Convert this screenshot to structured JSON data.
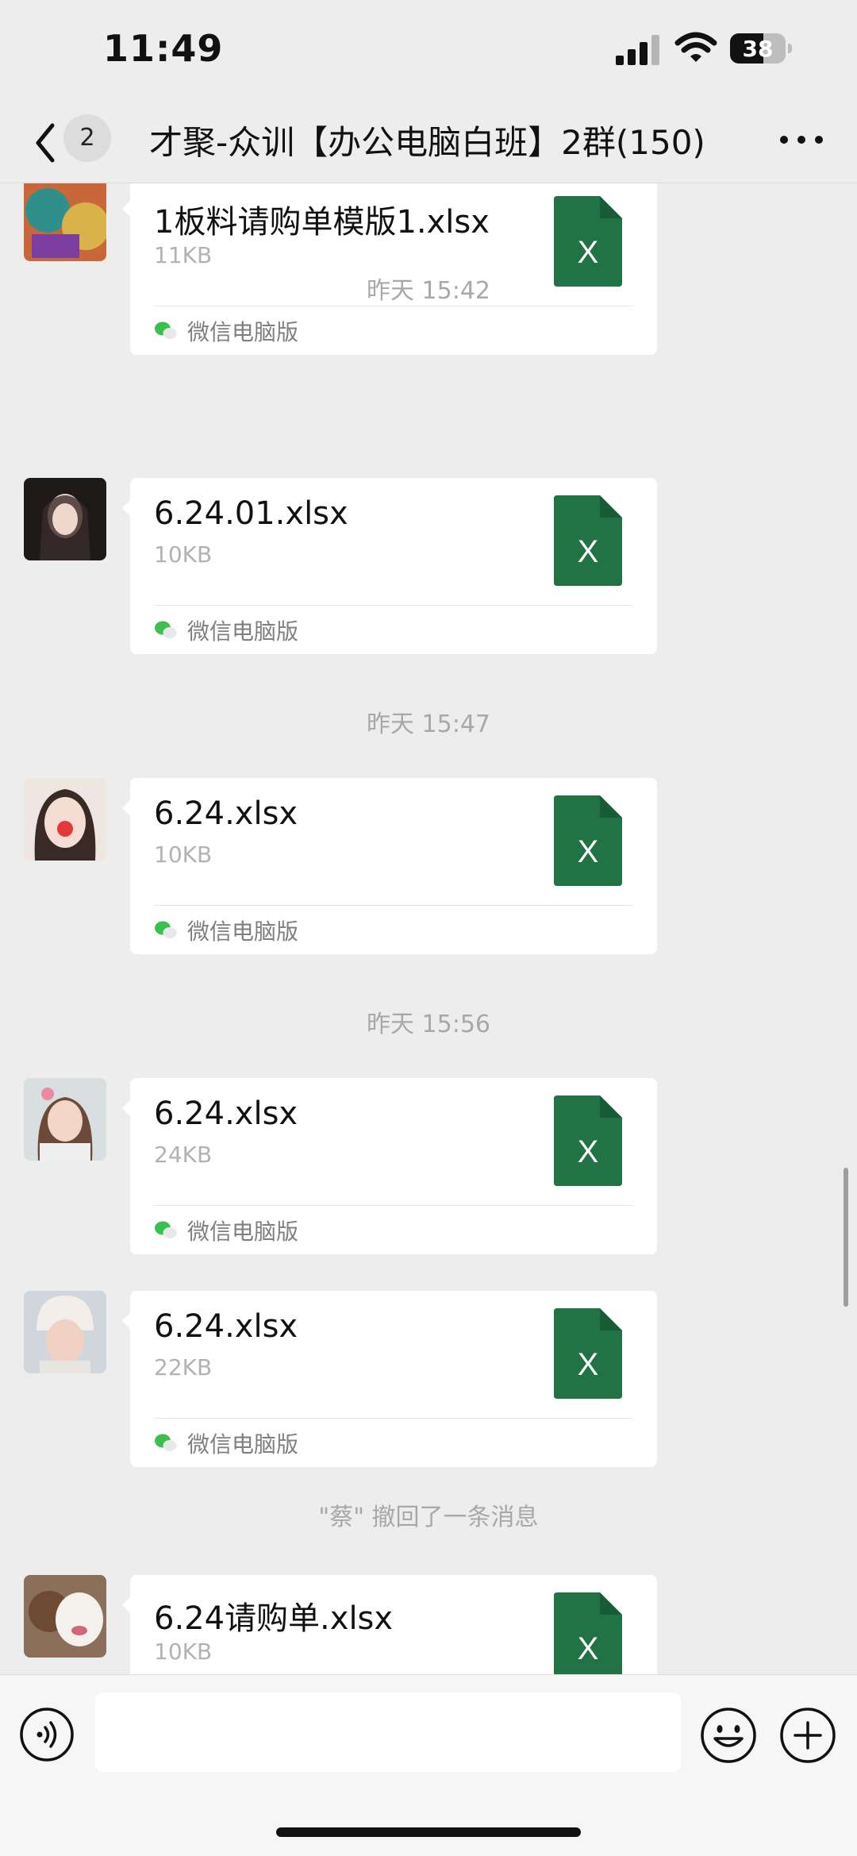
{
  "status": {
    "time": "11:49",
    "battery": "38"
  },
  "header": {
    "back_count": "2",
    "title": "才聚-众训【办公电脑白班】2群(150)"
  },
  "messages": [
    {
      "file_name": "1板料请购单模版1.xlsx",
      "size": "11KB",
      "source": "微信电脑版",
      "icon_letter": "X"
    },
    {
      "file_name": "6.24.01.xlsx",
      "size": "10KB",
      "source": "微信电脑版",
      "icon_letter": "X"
    },
    {
      "file_name": "6.24.xlsx",
      "size": "10KB",
      "source": "微信电脑版",
      "icon_letter": "X"
    },
    {
      "file_name": "6.24.xlsx",
      "size": "24KB",
      "source": "微信电脑版",
      "icon_letter": "X"
    },
    {
      "file_name": "6.24.xlsx",
      "size": "22KB",
      "source": "微信电脑版",
      "icon_letter": "X"
    },
    {
      "file_name": "6.24请购单.xlsx",
      "size": "10KB",
      "source": "",
      "icon_letter": "X"
    }
  ],
  "timestamps": [
    "昨天 15:42",
    "昨天 15:47",
    "昨天 15:56"
  ],
  "system_notice": "\"蔡\" 撤回了一条消息",
  "colors": {
    "excel_green": "#217346",
    "wechat_green": "#07c160",
    "background": "#ededed"
  }
}
